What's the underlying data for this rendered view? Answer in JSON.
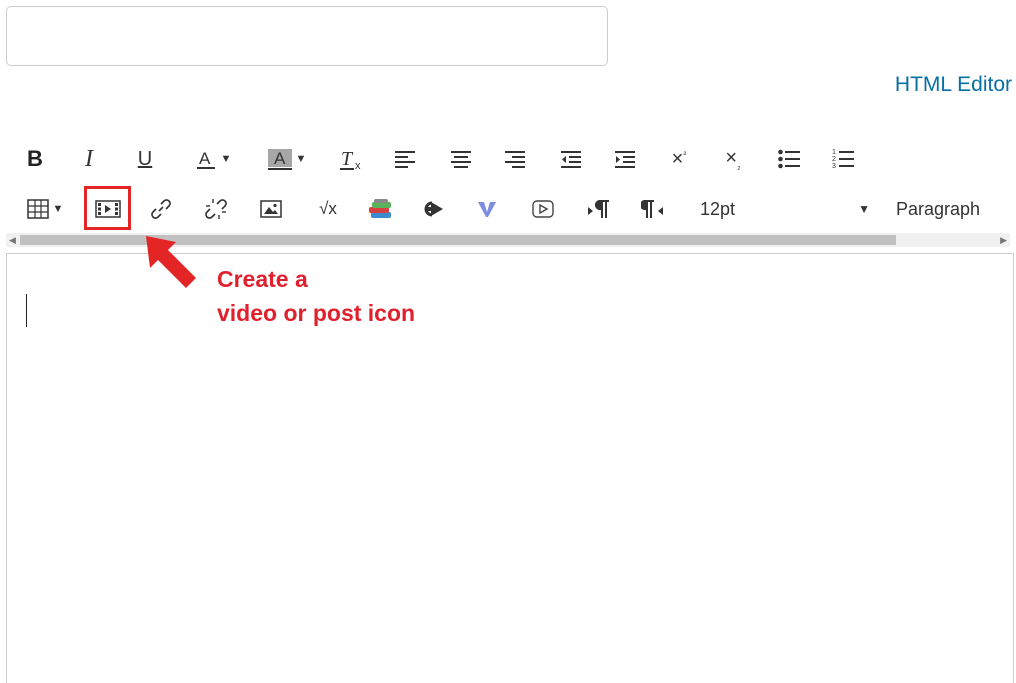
{
  "title_input": {
    "value": "",
    "placeholder": ""
  },
  "html_editor_link": "HTML Editor",
  "toolbar": {
    "row1": [
      {
        "name": "bold-button",
        "icon": "bold-icon"
      },
      {
        "name": "italic-button",
        "icon": "italic-icon"
      },
      {
        "name": "underline-button",
        "icon": "underline-icon"
      },
      {
        "name": "text-color-button",
        "icon": "text-color-icon"
      },
      {
        "name": "background-color-button",
        "icon": "background-color-icon"
      },
      {
        "name": "clear-formatting-button",
        "icon": "clear-formatting-icon"
      },
      {
        "name": "align-left-button",
        "icon": "align-left-icon"
      },
      {
        "name": "align-center-button",
        "icon": "align-center-icon"
      },
      {
        "name": "align-right-button",
        "icon": "align-right-icon"
      },
      {
        "name": "outdent-button",
        "icon": "outdent-icon"
      },
      {
        "name": "indent-button",
        "icon": "indent-icon"
      },
      {
        "name": "superscript-button",
        "icon": "superscript-icon"
      },
      {
        "name": "subscript-button",
        "icon": "subscript-icon"
      },
      {
        "name": "bullet-list-button",
        "icon": "bullet-list-icon"
      },
      {
        "name": "numbered-list-button",
        "icon": "numbered-list-icon"
      }
    ],
    "row2": [
      {
        "name": "table-button",
        "icon": "table-icon"
      },
      {
        "name": "record-media-button",
        "icon": "film-icon"
      },
      {
        "name": "link-button",
        "icon": "link-icon"
      },
      {
        "name": "unlink-button",
        "icon": "unlink-icon"
      },
      {
        "name": "embed-image-button",
        "icon": "image-icon"
      },
      {
        "name": "math-equation-button",
        "icon": "square-root-icon"
      },
      {
        "name": "books-tool-button",
        "icon": "books-icon"
      },
      {
        "name": "share-tool-button",
        "icon": "redirect-arrow-icon"
      },
      {
        "name": "vimeo-tool-button",
        "icon": "v-logo-icon"
      },
      {
        "name": "youtube-tool-button",
        "icon": "play-video-icon"
      },
      {
        "name": "ltr-direction-button",
        "icon": "pilcrow-ltr-icon"
      },
      {
        "name": "rtl-direction-button",
        "icon": "pilcrow-rtl-icon"
      }
    ],
    "font_size": "12pt",
    "block_format": "Paragraph"
  },
  "annotation": {
    "line1": "Create a",
    "line2": "video or post icon",
    "color": "#e0202c"
  },
  "colors": {
    "link": "#0770a3",
    "highlight": "#e32526"
  }
}
